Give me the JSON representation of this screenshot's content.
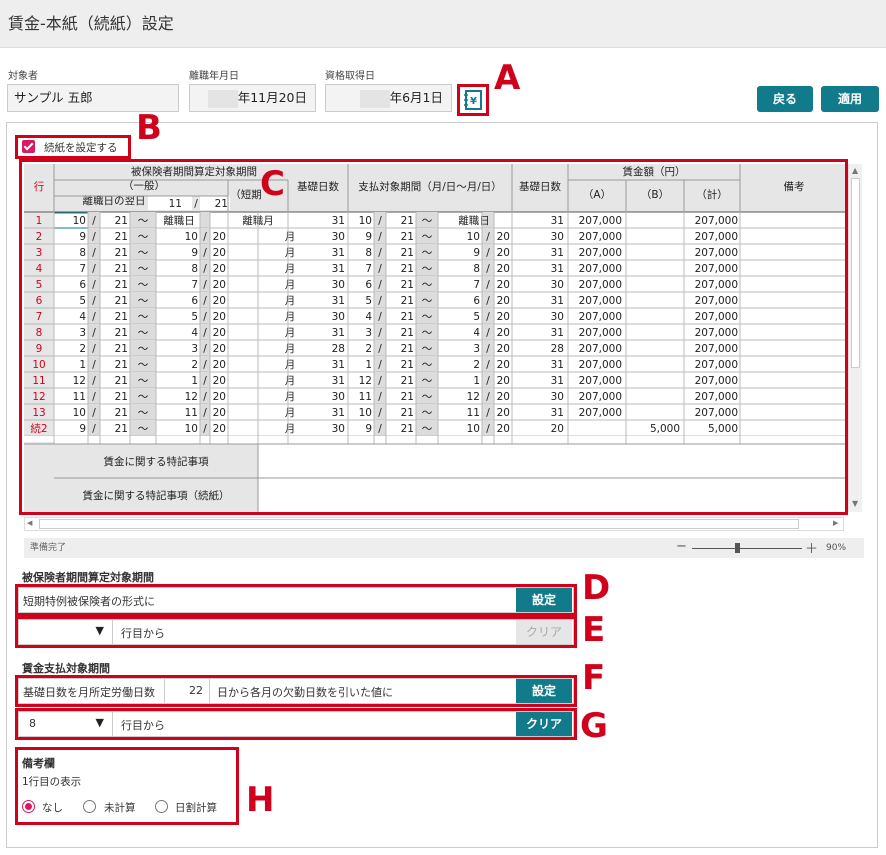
{
  "title": "賃金-本紙（続紙）設定",
  "fields": {
    "person_label": "対象者",
    "person_value": "サンプル 五郎",
    "leave_label": "離職年月日",
    "leave_value": "年11月20日",
    "qual_label": "資格取得日",
    "qual_value": "年6月1日"
  },
  "buttons": {
    "back": "戻る",
    "apply": "適用",
    "set": "設定",
    "clear": "クリア"
  },
  "annotations": [
    "A",
    "B",
    "C",
    "D",
    "E",
    "F",
    "G",
    "H"
  ],
  "checkbox_label": "続紙を設定する",
  "grid": {
    "hdr_row": "行",
    "hdr_insured": "被保険者期間算定対象期間",
    "hdr_general": "（一般）",
    "hdr_short": "（短期",
    "hdr_next_day": "離職日の翌日",
    "hdr_nd_m": "11",
    "hdr_nd_d": "21",
    "hdr_basis1": "基礎日数",
    "hdr_pay": "支払対象期間（月/日～月/日）",
    "hdr_basis2": "基礎日数",
    "hdr_wage": "賃金額（円）",
    "hdr_a": "（A）",
    "hdr_b": "（B）",
    "hdr_total": "（計）",
    "hdr_note": "備考",
    "slash": "/",
    "tilde": "～",
    "month": "月",
    "leave_day": "離職日",
    "leave_month": "離職月",
    "rows": [
      [
        "1",
        "10",
        "21",
        "",
        "",
        "",
        "31",
        "10",
        "21",
        "",
        "",
        "31",
        "207,000",
        "",
        "207,000"
      ],
      [
        "2",
        "9",
        "21",
        "10",
        "20",
        "月",
        "30",
        "9",
        "21",
        "10",
        "20",
        "30",
        "207,000",
        "",
        "207,000"
      ],
      [
        "3",
        "8",
        "21",
        "9",
        "20",
        "月",
        "31",
        "8",
        "21",
        "9",
        "20",
        "31",
        "207,000",
        "",
        "207,000"
      ],
      [
        "4",
        "7",
        "21",
        "8",
        "20",
        "月",
        "31",
        "7",
        "21",
        "8",
        "20",
        "31",
        "207,000",
        "",
        "207,000"
      ],
      [
        "5",
        "6",
        "21",
        "7",
        "20",
        "月",
        "30",
        "6",
        "21",
        "7",
        "20",
        "30",
        "207,000",
        "",
        "207,000"
      ],
      [
        "6",
        "5",
        "21",
        "6",
        "20",
        "月",
        "31",
        "5",
        "21",
        "6",
        "20",
        "31",
        "207,000",
        "",
        "207,000"
      ],
      [
        "7",
        "4",
        "21",
        "5",
        "20",
        "月",
        "30",
        "4",
        "21",
        "5",
        "20",
        "30",
        "207,000",
        "",
        "207,000"
      ],
      [
        "8",
        "3",
        "21",
        "4",
        "20",
        "月",
        "31",
        "3",
        "21",
        "4",
        "20",
        "31",
        "207,000",
        "",
        "207,000"
      ],
      [
        "9",
        "2",
        "21",
        "3",
        "20",
        "月",
        "28",
        "2",
        "21",
        "3",
        "20",
        "28",
        "207,000",
        "",
        "207,000"
      ],
      [
        "10",
        "1",
        "21",
        "2",
        "20",
        "月",
        "31",
        "1",
        "21",
        "2",
        "20",
        "31",
        "207,000",
        "",
        "207,000"
      ],
      [
        "11",
        "12",
        "21",
        "1",
        "20",
        "月",
        "31",
        "12",
        "21",
        "1",
        "20",
        "31",
        "207,000",
        "",
        "207,000"
      ],
      [
        "12",
        "11",
        "21",
        "12",
        "20",
        "月",
        "30",
        "11",
        "21",
        "12",
        "20",
        "30",
        "207,000",
        "",
        "207,000"
      ],
      [
        "13",
        "10",
        "21",
        "11",
        "20",
        "月",
        "31",
        "10",
        "21",
        "11",
        "20",
        "31",
        "207,000",
        "",
        "207,000"
      ],
      [
        "続2",
        "9",
        "21",
        "10",
        "20",
        "月",
        "30",
        "9",
        "21",
        "10",
        "20",
        "20",
        "",
        "5,000",
        "5,000"
      ]
    ],
    "special1": "賃金に関する特記事項",
    "special2": "賃金に関する特記事項（続紙）"
  },
  "status_text": "準備完了",
  "zoom": "90%",
  "zoom_minus": "−",
  "zoom_plus": "＋",
  "sec1_title": "被保険者期間算定対象期間",
  "sec1_text": "短期特例被保険者の形式に",
  "sec1_row_text": "行目から",
  "sec2_title": "賃金支払対象期間",
  "sec2_text1": "基礎日数を月所定労働日数",
  "sec2_value": "22",
  "sec2_text2": "日から各月の欠勤日数を引いた値に",
  "sec2_select": "8",
  "sec2_row_text": "行目から",
  "note_title": "備考欄",
  "note_sub": "1行目の表示",
  "radio": [
    "なし",
    "未計算",
    "日割計算"
  ]
}
